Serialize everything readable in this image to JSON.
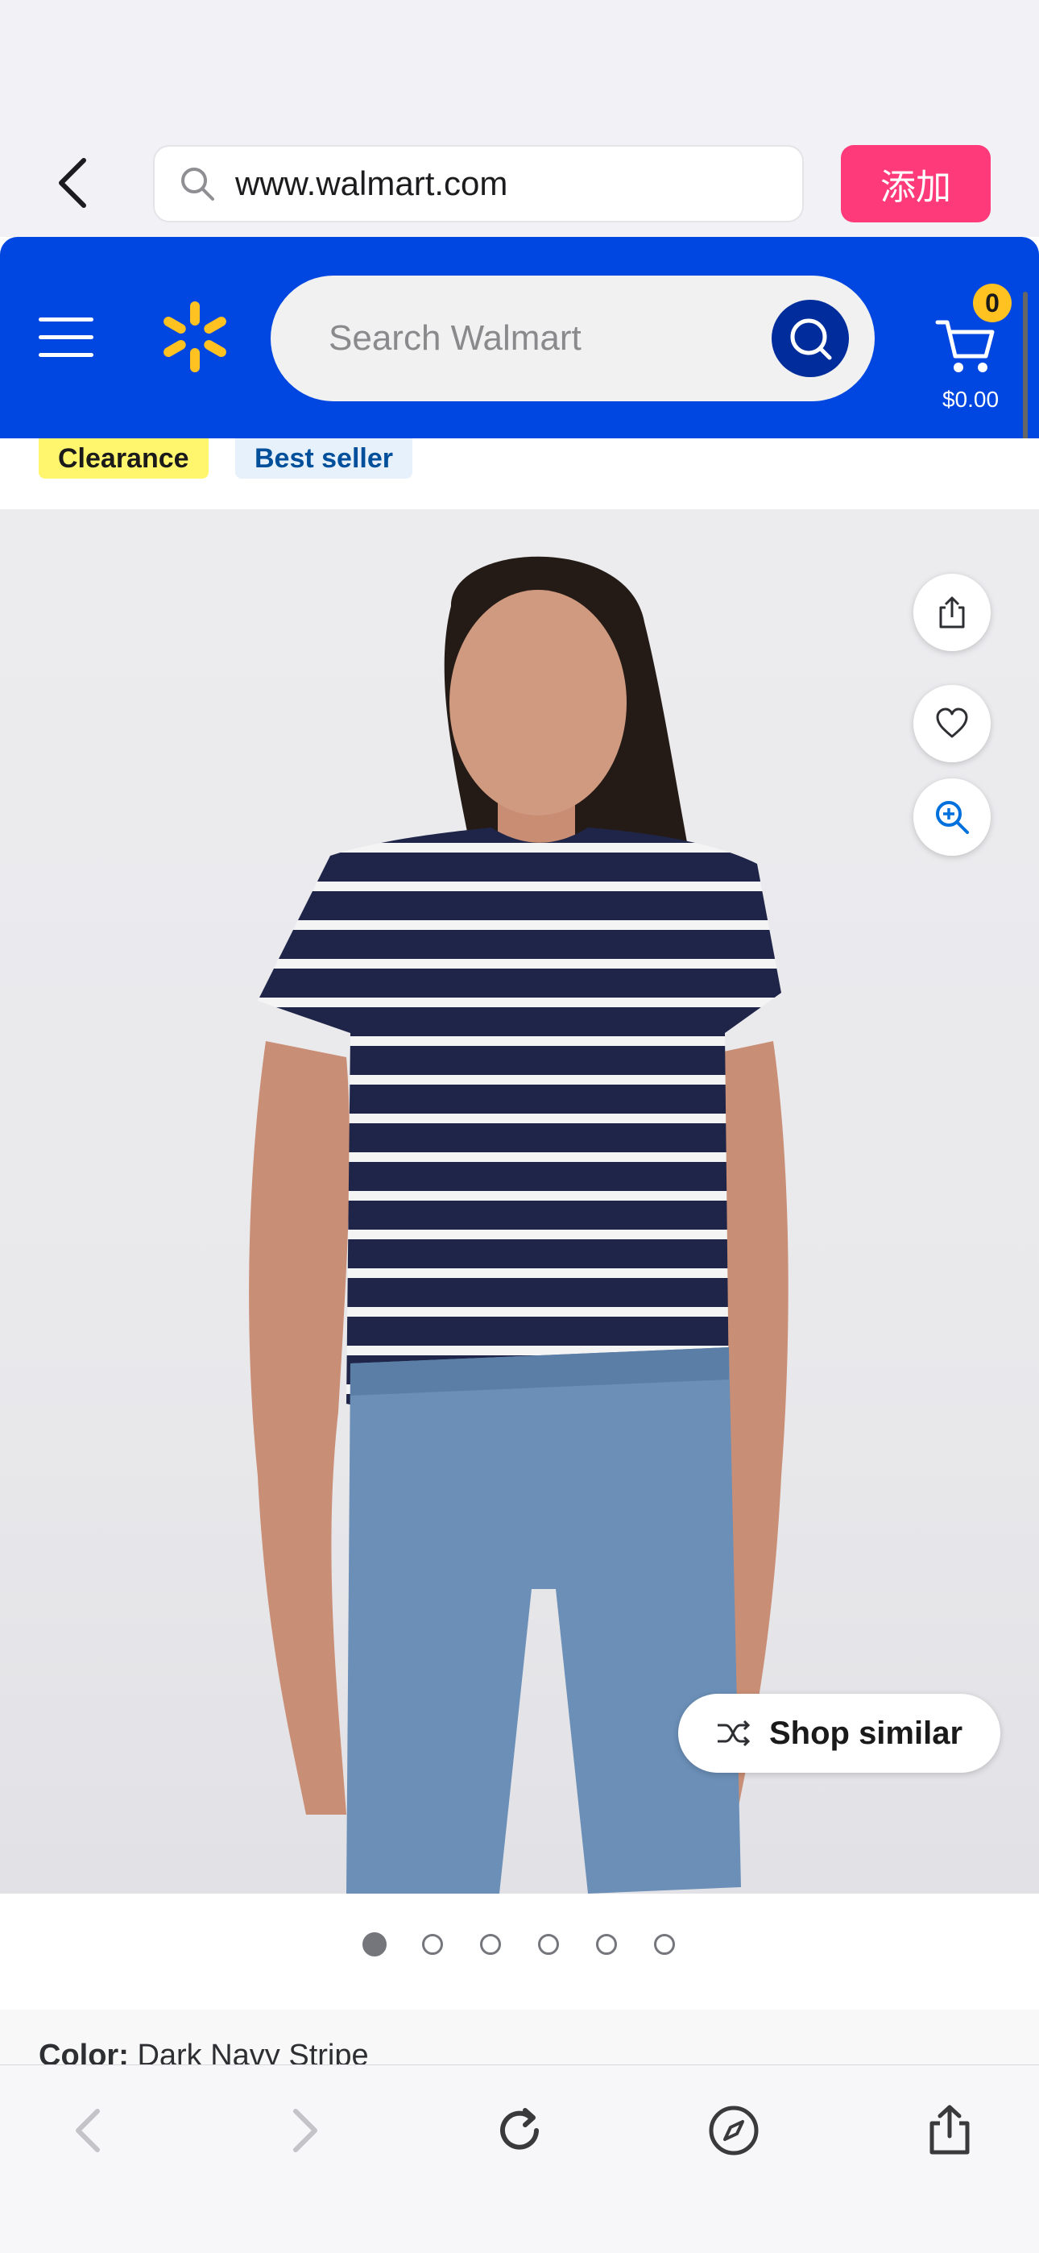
{
  "browser": {
    "url": "www.walmart.com",
    "add_button_label": "添加",
    "icons": {
      "back": "chevron-left-icon",
      "search": "search-icon"
    }
  },
  "header": {
    "search_placeholder": "Search Walmart",
    "cart_count": "0",
    "cart_total": "$0.00",
    "brand_color": "#0047e1",
    "spark_color": "#ffc220"
  },
  "tags": {
    "clearance": "Clearance",
    "best_seller": "Best seller"
  },
  "product": {
    "image_alt": "Woman wearing navy and white striped sleeveless top and denim shorts",
    "actions": [
      "share-icon",
      "heart-icon",
      "zoom-in-icon"
    ],
    "shop_similar_label": "Shop similar",
    "carousel": {
      "total": 6,
      "active_index": 0
    }
  },
  "color": {
    "label": "Color:",
    "value": "Dark Navy Stripe"
  },
  "toolbar": {
    "icons": [
      "back-arrow-icon",
      "forward-arrow-icon",
      "reload-icon",
      "compass-icon",
      "share-icon"
    ]
  }
}
